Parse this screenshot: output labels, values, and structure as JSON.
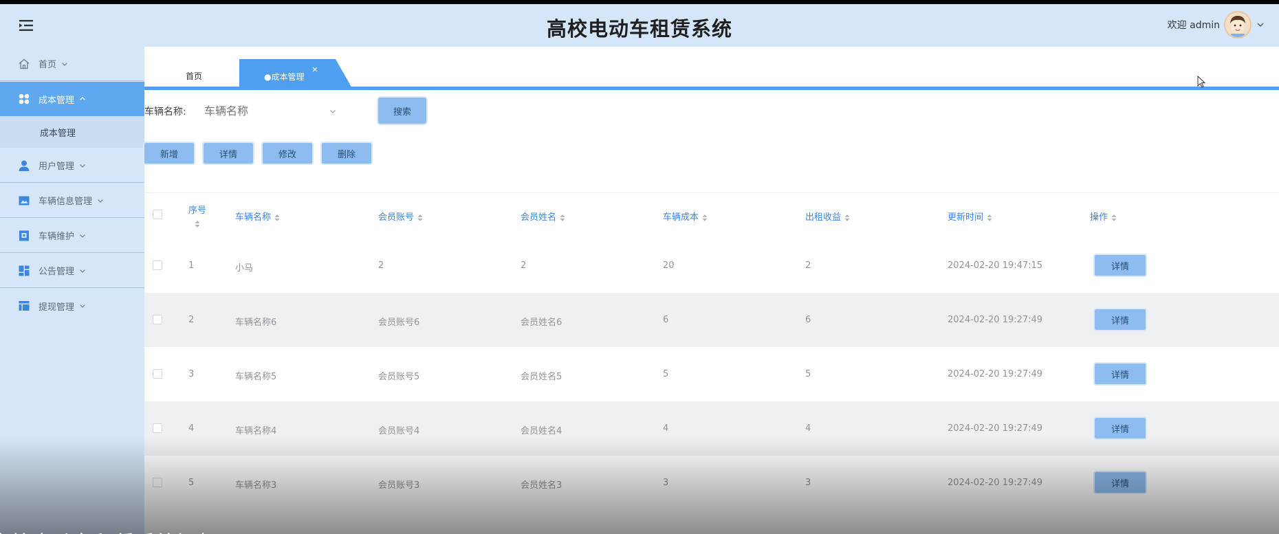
{
  "header": {
    "title": "高校电动车租赁系统",
    "welcome": "欢迎 admin"
  },
  "sidebar": {
    "items": [
      {
        "label": "首页",
        "icon": "home-icon"
      },
      {
        "label": "成本管理",
        "icon": "grid-icon",
        "active": true,
        "children": [
          {
            "label": "成本管理"
          }
        ]
      },
      {
        "label": "用户管理",
        "icon": "user-icon"
      },
      {
        "label": "车辆信息管理",
        "icon": "picture-icon"
      },
      {
        "label": "车辆维护",
        "icon": "box-icon"
      },
      {
        "label": "公告管理",
        "icon": "dashboard-icon"
      },
      {
        "label": "提现管理",
        "icon": "table-icon"
      }
    ]
  },
  "tabs": {
    "home": "首页",
    "active": "●成本管理"
  },
  "search": {
    "label": "车辆名称:",
    "placeholder": "车辆名称",
    "button": "搜索"
  },
  "actions": {
    "add": "新增",
    "detail": "详情",
    "edit": "修改",
    "delete": "删除"
  },
  "table": {
    "columns": [
      "序号",
      "车辆名称",
      "会员账号",
      "会员姓名",
      "车辆成本",
      "出租收益",
      "更新时间",
      "操作"
    ],
    "rows": [
      {
        "no": "1",
        "name": "小马",
        "account": "2",
        "member": "2",
        "cost": "20",
        "income": "2",
        "time": "2024-02-20 19:47:15",
        "op": "详情"
      },
      {
        "no": "2",
        "name": "车辆名称6",
        "account": "会员账号6",
        "member": "会员姓名6",
        "cost": "6",
        "income": "6",
        "time": "2024-02-20 19:27:49",
        "op": "详情"
      },
      {
        "no": "3",
        "name": "车辆名称5",
        "account": "会员账号5",
        "member": "会员姓名5",
        "cost": "5",
        "income": "5",
        "time": "2024-02-20 19:27:49",
        "op": "详情"
      },
      {
        "no": "4",
        "name": "车辆名称4",
        "account": "会员账号4",
        "member": "会员姓名4",
        "cost": "4",
        "income": "4",
        "time": "2024-02-20 19:27:49",
        "op": "详情"
      },
      {
        "no": "5",
        "name": "车辆名称3",
        "account": "会员账号3",
        "member": "会员姓名3",
        "cost": "3",
        "income": "3",
        "time": "2024-02-20 19:27:49",
        "op": "详情"
      }
    ]
  },
  "overlay": {
    "caption": "高校电动车租赁系统视频"
  },
  "colors": {
    "header_bg": "#d5e6f8",
    "accent": "#4e9ff0",
    "active_nav": "#5fa8ee",
    "button": "#8dbcf0"
  }
}
